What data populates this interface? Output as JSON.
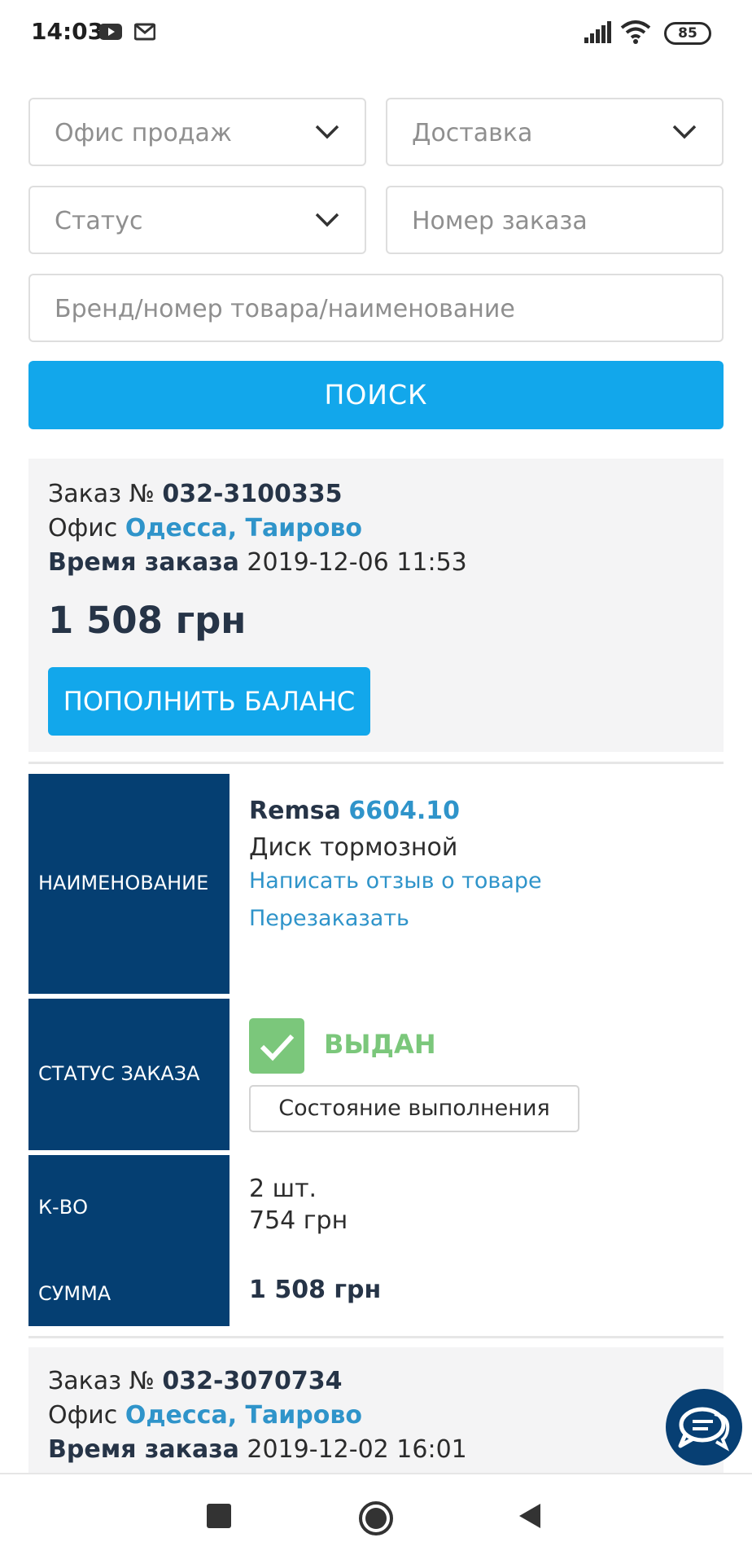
{
  "status_bar": {
    "time": "14:03",
    "battery": "85"
  },
  "filters": {
    "sales_office_placeholder": "Офис продаж",
    "delivery_placeholder": "Доставка",
    "status_placeholder": "Статус",
    "order_number_placeholder": "Номер заказа",
    "product_placeholder": "Бренд/номер товара/наименование",
    "search_label": "ПОИСК"
  },
  "orders": [
    {
      "order_label": "Заказ №",
      "order_number": "032-3100335",
      "office_label": "Офис",
      "office_value": "Одесса, Таирово",
      "time_label": "Время заказа",
      "time_value": "2019-12-06 11:53",
      "amount": "1 508 грн",
      "topup_label": "ПОПОЛНИТЬ БАЛАНС",
      "table": {
        "name_header": "НАИМЕНОВАНИЕ",
        "status_header": "СТАТУС ЗАКАЗА",
        "qty_header": "К-ВО",
        "sum_header": "СУММА",
        "brand": "Remsa",
        "article": "6604.10",
        "product_name": "Диск тормозной",
        "review_link": "Написать отзыв о товаре",
        "reorder_link": "Перезаказать",
        "status": "ВЫДАН",
        "state_button": "Состояние выполнения",
        "quantity": "2 шт.",
        "unit_price": "754 грн",
        "sum": "1 508 грн"
      }
    },
    {
      "order_label": "Заказ №",
      "order_number": "032-3070734",
      "office_label": "Офис",
      "office_value": "Одесса, Таирово",
      "time_label": "Время заказа",
      "time_value": "2019-12-02 16:01"
    }
  ],
  "icons": {
    "youtube": "youtube-icon",
    "gmail": "gmail-icon",
    "signal": "signal-icon",
    "wifi": "wifi-icon",
    "chevron": "chevron-down-icon",
    "check": "check-icon",
    "chat": "chat-icon",
    "nav_recents": "recents-icon",
    "nav_home": "home-icon",
    "nav_back": "back-icon"
  },
  "colors": {
    "accent": "#12a7eb",
    "table_header": "#053f72",
    "link": "#2f94ca",
    "success": "#7bc77b",
    "card_bg": "#f4f4f5"
  }
}
